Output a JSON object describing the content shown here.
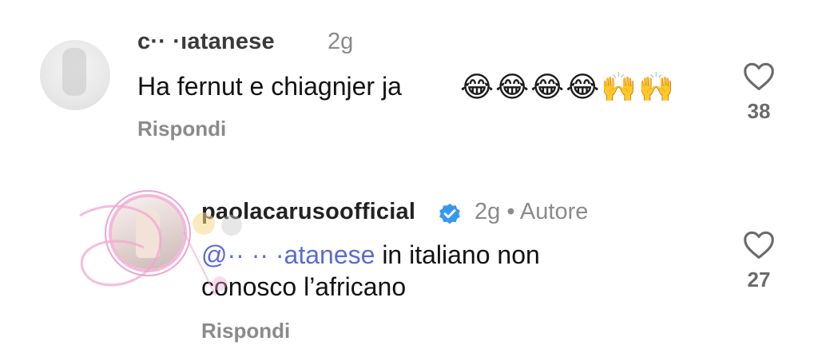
{
  "comments": [
    {
      "username": "c·· ·ıatanese",
      "time": "2g",
      "text": "Ha fernut e chiagnjer ja",
      "emojis": "😂😂😂😂🙌🙌",
      "reply_label": "Rispondi",
      "likes": "38"
    },
    {
      "username": "paolacarusoofficial",
      "meta": "2g • Autore",
      "mention": "@·· ·· ·atanese",
      "text_line1_rest": " in italiano non",
      "text_line2": "conosco l’africano",
      "reply_label": "Rispondi",
      "likes": "27"
    }
  ],
  "icons": {
    "like": "heart-outline-icon",
    "verified": "verified-badge-icon"
  },
  "colors": {
    "mention": "#5a6ad6",
    "verified": "#3897f0",
    "muted": "#8a8a8a"
  }
}
